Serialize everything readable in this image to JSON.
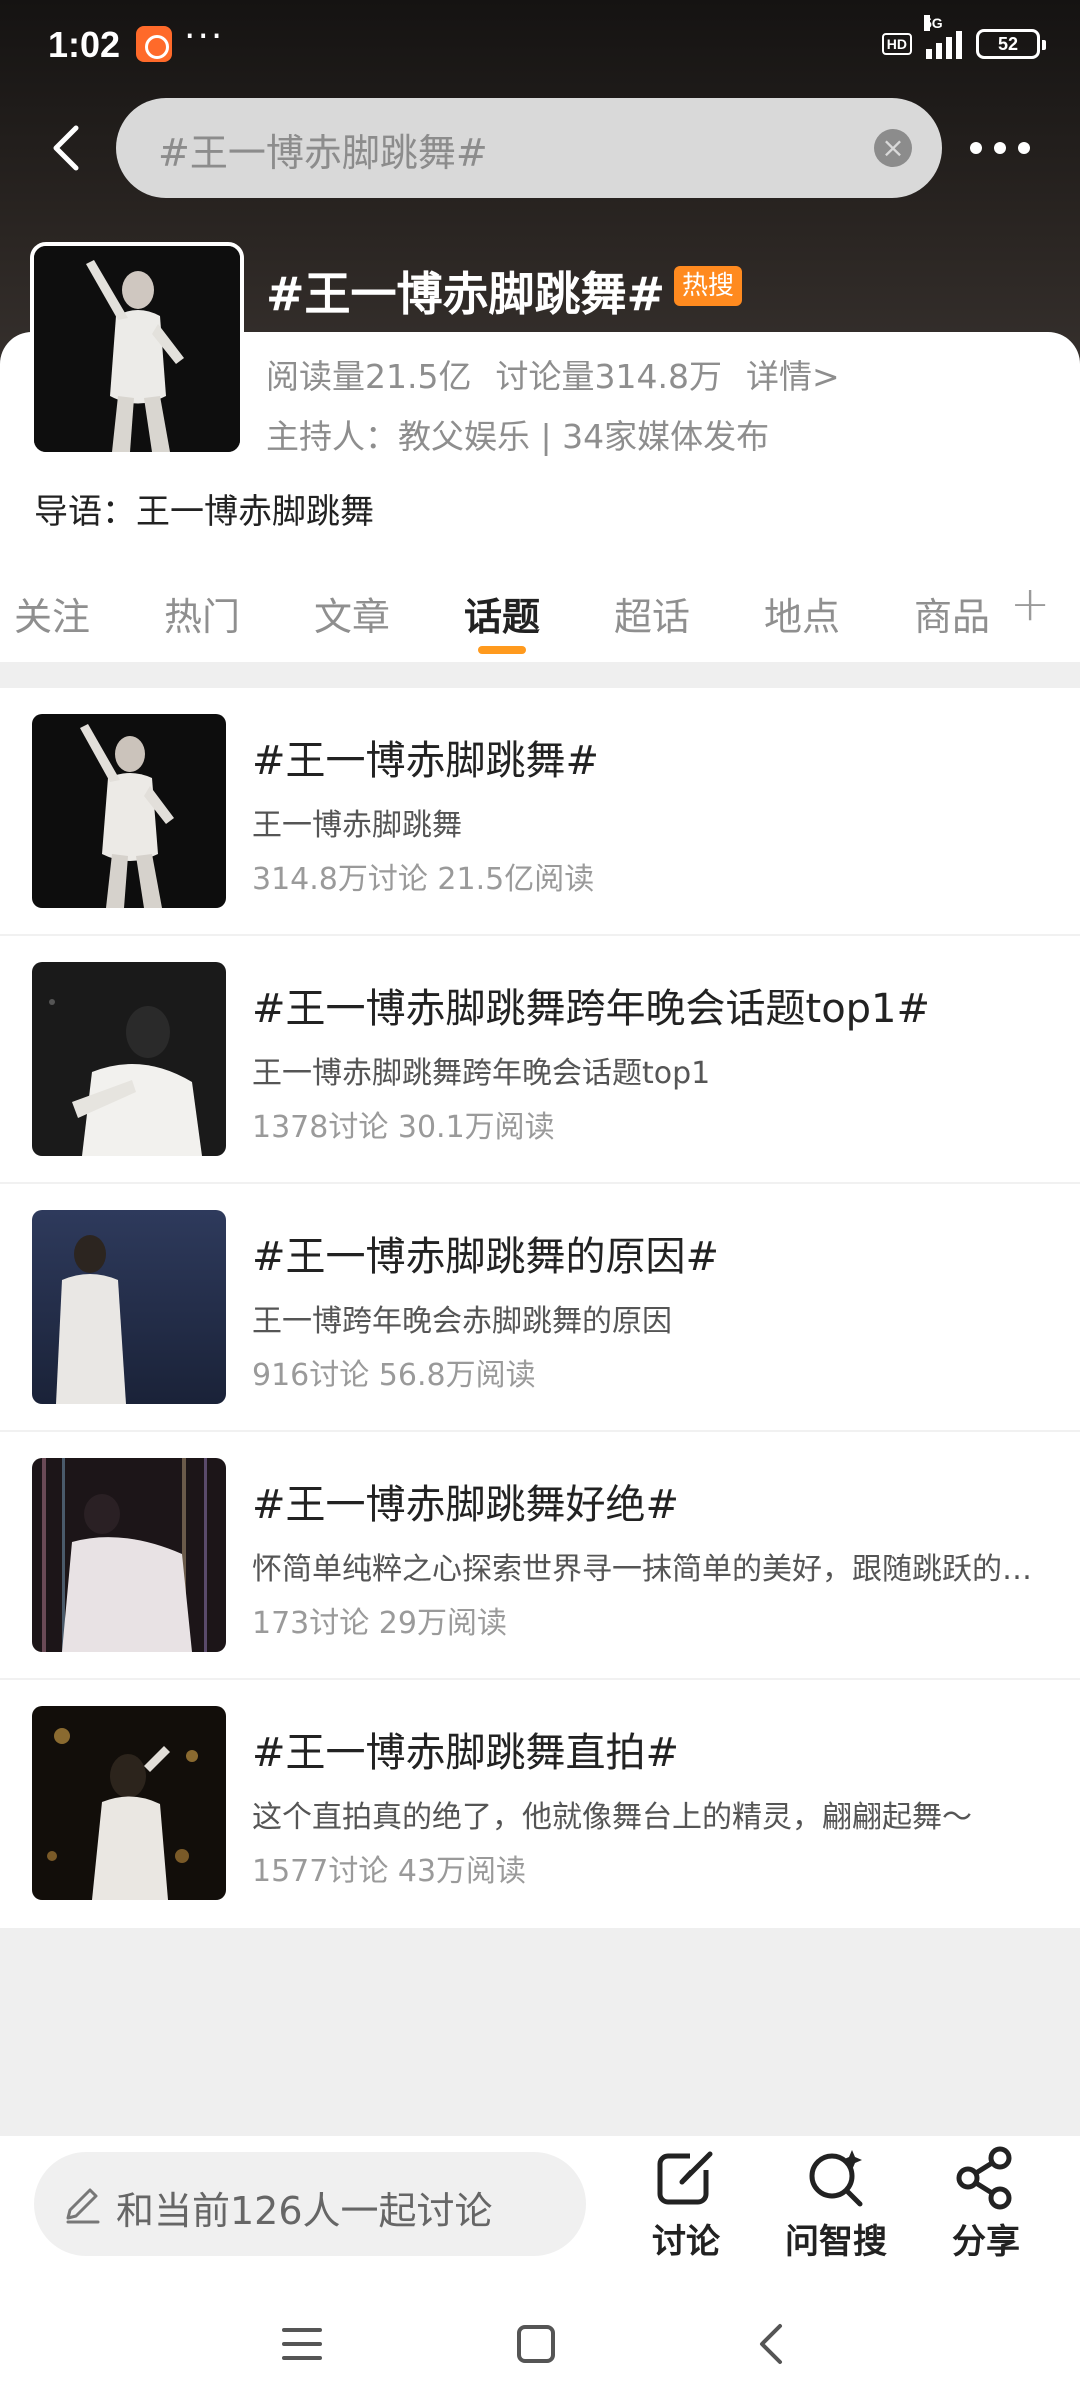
{
  "status_bar": {
    "time": "1:02",
    "dots": "···",
    "network": "5G",
    "hd": "HD",
    "battery": "52"
  },
  "search": {
    "query": "#王一博赤脚跳舞#"
  },
  "topic": {
    "title": "#王一博赤脚跳舞#",
    "badge": "热搜",
    "reads": "阅读量21.5亿",
    "discussions": "讨论量314.8万",
    "details": "详情>",
    "host": "主持人：教父娱乐 | 34家媒体发布",
    "guide": "导语：王一博赤脚跳舞"
  },
  "tabs": [
    {
      "label": "关注"
    },
    {
      "label": "热门"
    },
    {
      "label": "文章"
    },
    {
      "label": "话题"
    },
    {
      "label": "超话"
    },
    {
      "label": "地点"
    },
    {
      "label": "商品"
    }
  ],
  "active_tab": "话题",
  "results": [
    {
      "title": "#王一博赤脚跳舞#",
      "desc": "王一博赤脚跳舞",
      "meta": "314.8万讨论 21.5亿阅读"
    },
    {
      "title": "#王一博赤脚跳舞跨年晚会话题top1#",
      "desc": "王一博赤脚跳舞跨年晚会话题top1",
      "meta": "1378讨论 30.1万阅读"
    },
    {
      "title": "#王一博赤脚跳舞的原因#",
      "desc": "王一博跨年晚会赤脚跳舞的原因",
      "meta": "916讨论 56.8万阅读"
    },
    {
      "title": "#王一博赤脚跳舞好绝#",
      "desc": "怀简单纯粹之心探索世界寻一抹简单的美好，跟随跳跃的节奏",
      "meta": "173讨论 29万阅读"
    },
    {
      "title": "#王一博赤脚跳舞直拍#",
      "desc": "这个直拍真的绝了，他就像舞台上的精灵，翩翩起舞～",
      "meta": "1577讨论 43万阅读"
    }
  ],
  "bottom": {
    "compose_placeholder": "和当前126人一起讨论",
    "discuss_label": "讨论",
    "ask_label": "问智搜",
    "share_label": "分享"
  },
  "colors": {
    "accent": "#ff9a1e",
    "hot_badge": "#ff8a1f",
    "header_dark": "#1c1917"
  },
  "icons": [
    "back-icon",
    "clear-icon",
    "more-icon",
    "add-tab-icon",
    "pencil-icon",
    "compose-icon",
    "ai-search-icon",
    "share-icon",
    "menu-icon",
    "home-icon",
    "nav-back-icon"
  ]
}
